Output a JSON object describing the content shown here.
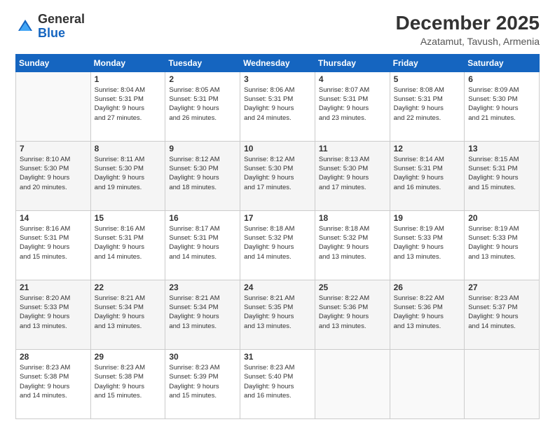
{
  "header": {
    "logo": {
      "general": "General",
      "blue": "Blue"
    },
    "title": "December 2025",
    "subtitle": "Azatamut, Tavush, Armenia"
  },
  "calendar": {
    "days_of_week": [
      "Sunday",
      "Monday",
      "Tuesday",
      "Wednesday",
      "Thursday",
      "Friday",
      "Saturday"
    ],
    "weeks": [
      [
        {
          "num": "",
          "info": ""
        },
        {
          "num": "1",
          "info": "Sunrise: 8:04 AM\nSunset: 5:31 PM\nDaylight: 9 hours\nand 27 minutes."
        },
        {
          "num": "2",
          "info": "Sunrise: 8:05 AM\nSunset: 5:31 PM\nDaylight: 9 hours\nand 26 minutes."
        },
        {
          "num": "3",
          "info": "Sunrise: 8:06 AM\nSunset: 5:31 PM\nDaylight: 9 hours\nand 24 minutes."
        },
        {
          "num": "4",
          "info": "Sunrise: 8:07 AM\nSunset: 5:31 PM\nDaylight: 9 hours\nand 23 minutes."
        },
        {
          "num": "5",
          "info": "Sunrise: 8:08 AM\nSunset: 5:31 PM\nDaylight: 9 hours\nand 22 minutes."
        },
        {
          "num": "6",
          "info": "Sunrise: 8:09 AM\nSunset: 5:30 PM\nDaylight: 9 hours\nand 21 minutes."
        }
      ],
      [
        {
          "num": "7",
          "info": "Sunrise: 8:10 AM\nSunset: 5:30 PM\nDaylight: 9 hours\nand 20 minutes."
        },
        {
          "num": "8",
          "info": "Sunrise: 8:11 AM\nSunset: 5:30 PM\nDaylight: 9 hours\nand 19 minutes."
        },
        {
          "num": "9",
          "info": "Sunrise: 8:12 AM\nSunset: 5:30 PM\nDaylight: 9 hours\nand 18 minutes."
        },
        {
          "num": "10",
          "info": "Sunrise: 8:12 AM\nSunset: 5:30 PM\nDaylight: 9 hours\nand 17 minutes."
        },
        {
          "num": "11",
          "info": "Sunrise: 8:13 AM\nSunset: 5:30 PM\nDaylight: 9 hours\nand 17 minutes."
        },
        {
          "num": "12",
          "info": "Sunrise: 8:14 AM\nSunset: 5:31 PM\nDaylight: 9 hours\nand 16 minutes."
        },
        {
          "num": "13",
          "info": "Sunrise: 8:15 AM\nSunset: 5:31 PM\nDaylight: 9 hours\nand 15 minutes."
        }
      ],
      [
        {
          "num": "14",
          "info": "Sunrise: 8:16 AM\nSunset: 5:31 PM\nDaylight: 9 hours\nand 15 minutes."
        },
        {
          "num": "15",
          "info": "Sunrise: 8:16 AM\nSunset: 5:31 PM\nDaylight: 9 hours\nand 14 minutes."
        },
        {
          "num": "16",
          "info": "Sunrise: 8:17 AM\nSunset: 5:31 PM\nDaylight: 9 hours\nand 14 minutes."
        },
        {
          "num": "17",
          "info": "Sunrise: 8:18 AM\nSunset: 5:32 PM\nDaylight: 9 hours\nand 14 minutes."
        },
        {
          "num": "18",
          "info": "Sunrise: 8:18 AM\nSunset: 5:32 PM\nDaylight: 9 hours\nand 13 minutes."
        },
        {
          "num": "19",
          "info": "Sunrise: 8:19 AM\nSunset: 5:33 PM\nDaylight: 9 hours\nand 13 minutes."
        },
        {
          "num": "20",
          "info": "Sunrise: 8:19 AM\nSunset: 5:33 PM\nDaylight: 9 hours\nand 13 minutes."
        }
      ],
      [
        {
          "num": "21",
          "info": "Sunrise: 8:20 AM\nSunset: 5:33 PM\nDaylight: 9 hours\nand 13 minutes."
        },
        {
          "num": "22",
          "info": "Sunrise: 8:21 AM\nSunset: 5:34 PM\nDaylight: 9 hours\nand 13 minutes."
        },
        {
          "num": "23",
          "info": "Sunrise: 8:21 AM\nSunset: 5:34 PM\nDaylight: 9 hours\nand 13 minutes."
        },
        {
          "num": "24",
          "info": "Sunrise: 8:21 AM\nSunset: 5:35 PM\nDaylight: 9 hours\nand 13 minutes."
        },
        {
          "num": "25",
          "info": "Sunrise: 8:22 AM\nSunset: 5:36 PM\nDaylight: 9 hours\nand 13 minutes."
        },
        {
          "num": "26",
          "info": "Sunrise: 8:22 AM\nSunset: 5:36 PM\nDaylight: 9 hours\nand 13 minutes."
        },
        {
          "num": "27",
          "info": "Sunrise: 8:23 AM\nSunset: 5:37 PM\nDaylight: 9 hours\nand 14 minutes."
        }
      ],
      [
        {
          "num": "28",
          "info": "Sunrise: 8:23 AM\nSunset: 5:38 PM\nDaylight: 9 hours\nand 14 minutes."
        },
        {
          "num": "29",
          "info": "Sunrise: 8:23 AM\nSunset: 5:38 PM\nDaylight: 9 hours\nand 15 minutes."
        },
        {
          "num": "30",
          "info": "Sunrise: 8:23 AM\nSunset: 5:39 PM\nDaylight: 9 hours\nand 15 minutes."
        },
        {
          "num": "31",
          "info": "Sunrise: 8:23 AM\nSunset: 5:40 PM\nDaylight: 9 hours\nand 16 minutes."
        },
        {
          "num": "",
          "info": ""
        },
        {
          "num": "",
          "info": ""
        },
        {
          "num": "",
          "info": ""
        }
      ]
    ]
  }
}
